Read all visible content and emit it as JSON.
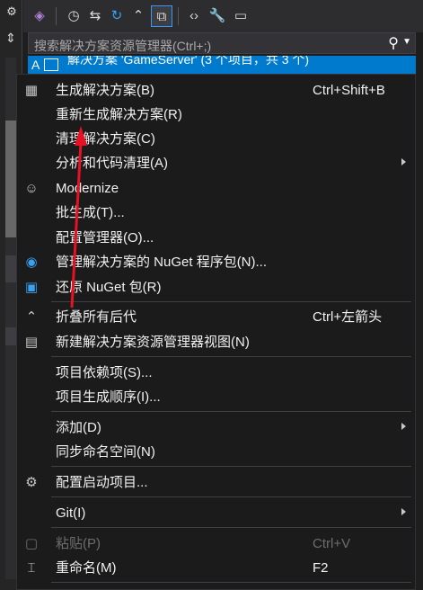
{
  "left_strip": {
    "gear_icon": "gear-icon",
    "split_icon": "split-icon"
  },
  "toolbar": {
    "icons": [
      "vs-icon",
      "history-icon",
      "sync-icon",
      "refresh-icon",
      "collapse-icon",
      "copy-icon",
      "code-icon",
      "wrench-icon",
      "preview-icon"
    ]
  },
  "search": {
    "placeholder": "搜索解决方案资源管理器(Ctrl+;)"
  },
  "solution_row": {
    "prefix": "A",
    "text": "解决方案 'GameServer' (3 个项目，共 3 个)"
  },
  "menu": {
    "items": [
      {
        "label": "生成解决方案(B)",
        "shortcut": "Ctrl+Shift+B",
        "icon": "build-icon"
      },
      {
        "label": "重新生成解决方案(R)",
        "shortcut": "",
        "icon": ""
      },
      {
        "label": "清理解决方案(C)",
        "shortcut": "",
        "icon": ""
      },
      {
        "label": "分析和代码清理(A)",
        "shortcut": "",
        "icon": "",
        "submenu": true
      },
      {
        "label": "Modernize",
        "shortcut": "",
        "icon": "copilot-icon"
      },
      {
        "label": "批生成(T)...",
        "shortcut": "",
        "icon": ""
      },
      {
        "label": "配置管理器(O)...",
        "shortcut": "",
        "icon": ""
      },
      {
        "label": "管理解决方案的 NuGet 程序包(N)...",
        "shortcut": "",
        "icon": "nuget-icon"
      },
      {
        "label": "还原 NuGet 包(R)",
        "shortcut": "",
        "icon": "restore-icon"
      },
      {
        "label": "折叠所有后代",
        "shortcut": "Ctrl+左箭头",
        "icon": "collapse-all-icon"
      },
      {
        "label": "新建解决方案资源管理器视图(N)",
        "shortcut": "",
        "icon": "new-view-icon"
      },
      {
        "label": "项目依赖项(S)...",
        "shortcut": "",
        "icon": ""
      },
      {
        "label": "项目生成顺序(I)...",
        "shortcut": "",
        "icon": ""
      },
      {
        "label": "添加(D)",
        "shortcut": "",
        "icon": "",
        "submenu": true
      },
      {
        "label": "同步命名空间(N)",
        "shortcut": "",
        "icon": ""
      },
      {
        "label": "配置启动项目...",
        "shortcut": "",
        "icon": "settings-icon"
      },
      {
        "label": "Git(I)",
        "shortcut": "",
        "icon": "",
        "submenu": true
      },
      {
        "label": "粘贴(P)",
        "shortcut": "Ctrl+V",
        "icon": "paste-icon",
        "disabled": true
      },
      {
        "label": "重命名(M)",
        "shortcut": "F2",
        "icon": "rename-icon"
      }
    ]
  },
  "colors": {
    "accent": "#007acc",
    "arrow": "#e81123",
    "menu_bg": "#1b1b1c"
  }
}
